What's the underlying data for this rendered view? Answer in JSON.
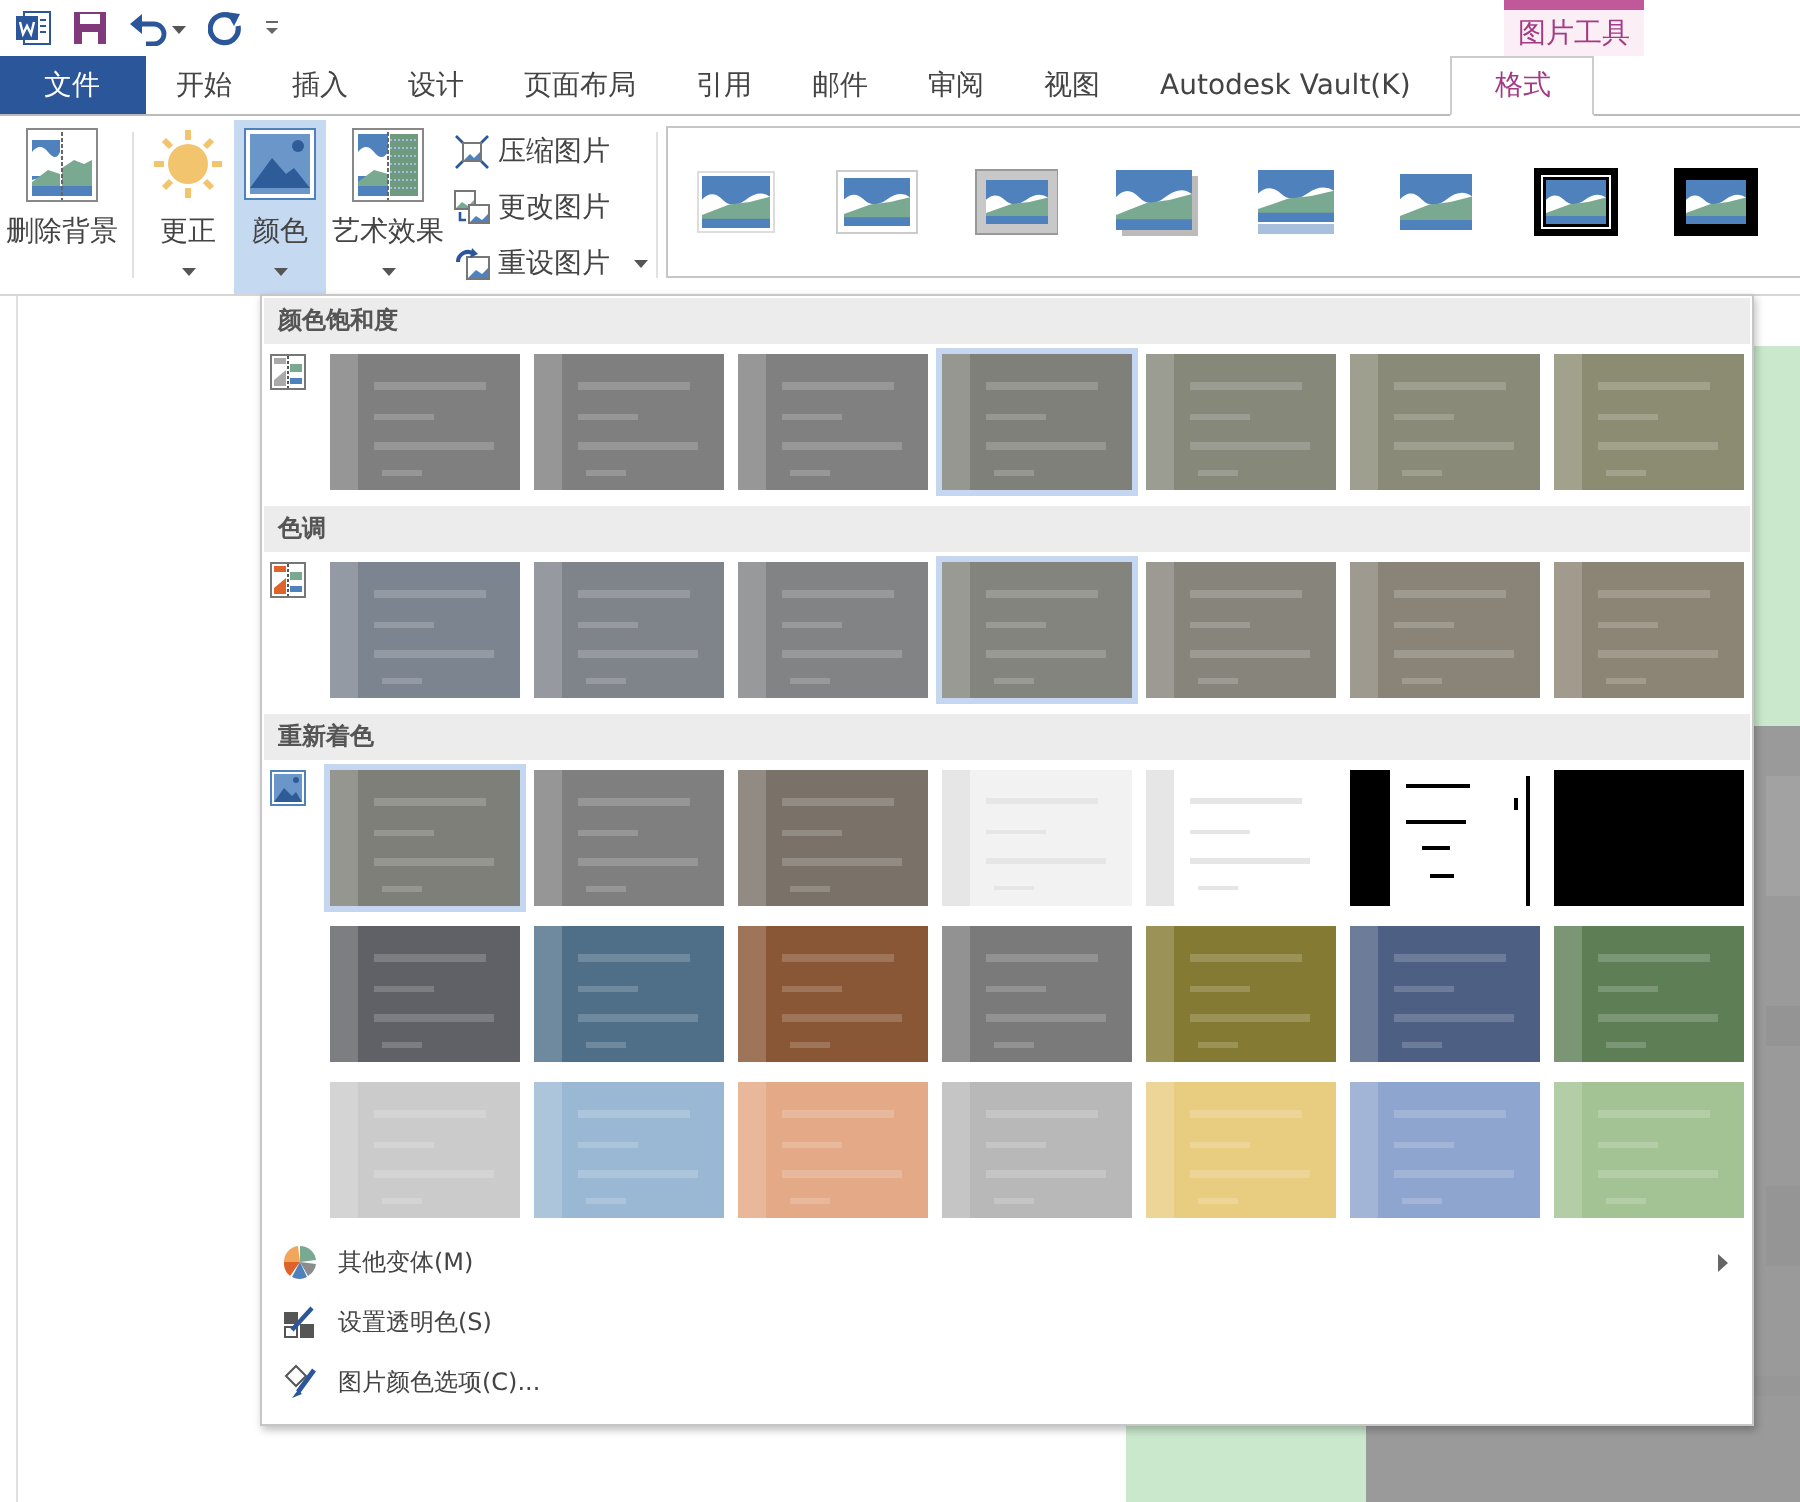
{
  "contextual_group": {
    "label": "图片工具"
  },
  "tabs": [
    {
      "label": "文件",
      "kind": "file",
      "selected": false
    },
    {
      "label": "开始",
      "kind": "normal",
      "selected": false
    },
    {
      "label": "插入",
      "kind": "normal",
      "selected": false
    },
    {
      "label": "设计",
      "kind": "normal",
      "selected": false
    },
    {
      "label": "页面布局",
      "kind": "normal",
      "selected": false
    },
    {
      "label": "引用",
      "kind": "normal",
      "selected": false
    },
    {
      "label": "邮件",
      "kind": "normal",
      "selected": false
    },
    {
      "label": "审阅",
      "kind": "normal",
      "selected": false
    },
    {
      "label": "视图",
      "kind": "normal",
      "selected": false
    },
    {
      "label": "Autodesk Vault(K)",
      "kind": "normal",
      "selected": false
    },
    {
      "label": "格式",
      "kind": "contextual",
      "selected": true
    }
  ],
  "ribbon": {
    "large_buttons": [
      {
        "label": "删除背景",
        "kind": "remove-background",
        "dropdown": false,
        "selected": false
      },
      {
        "label": "更正",
        "kind": "corrections",
        "dropdown": true,
        "selected": false
      },
      {
        "label": "颜色",
        "kind": "color",
        "dropdown": true,
        "selected": true
      },
      {
        "label": "艺术效果",
        "kind": "artistic",
        "dropdown": true,
        "selected": false
      }
    ],
    "small_buttons": [
      {
        "label": "压缩图片",
        "kind": "compress",
        "dropdown": false
      },
      {
        "label": "更改图片",
        "kind": "change",
        "dropdown": false
      },
      {
        "label": "重设图片",
        "kind": "reset",
        "dropdown": true
      }
    ],
    "picture_styles": [
      {
        "kind": "simple-frame"
      },
      {
        "kind": "white-frame"
      },
      {
        "kind": "gray-frame"
      },
      {
        "kind": "drop-shadow"
      },
      {
        "kind": "reflection"
      },
      {
        "kind": "soft-edge"
      },
      {
        "kind": "double-black"
      },
      {
        "kind": "thick-black"
      }
    ]
  },
  "color_menu": {
    "sections": [
      {
        "title": "颜色饱和度",
        "kind": "saturation",
        "rows": [
          [
            {
              "kind": "tint",
              "color": "#7f7f7f",
              "selected": false
            },
            {
              "kind": "tint",
              "color": "#7f7f7f",
              "selected": false
            },
            {
              "kind": "tint",
              "color": "#808080",
              "selected": false
            },
            {
              "kind": "tint",
              "color": "#7f8079",
              "selected": true
            },
            {
              "kind": "tint",
              "color": "#86887a",
              "selected": false
            },
            {
              "kind": "tint",
              "color": "#8a8a78",
              "selected": false
            },
            {
              "kind": "tint",
              "color": "#8c8c73",
              "selected": false
            }
          ]
        ]
      },
      {
        "title": "色调",
        "kind": "tone",
        "rows": [
          [
            {
              "kind": "tint",
              "color": "#7c8490",
              "selected": false
            },
            {
              "kind": "tint",
              "color": "#7f848b",
              "selected": false
            },
            {
              "kind": "tint",
              "color": "#828385",
              "selected": false
            },
            {
              "kind": "tint",
              "color": "#84847e",
              "selected": true
            },
            {
              "kind": "tint",
              "color": "#87847c",
              "selected": false
            },
            {
              "kind": "tint",
              "color": "#8a8478",
              "selected": false
            },
            {
              "kind": "tint",
              "color": "#8c8474",
              "selected": false
            }
          ]
        ]
      },
      {
        "title": "重新着色",
        "kind": "recolor",
        "rows": [
          [
            {
              "kind": "tint",
              "color": "#7e7f78",
              "selected": true
            },
            {
              "kind": "tint",
              "color": "#7f7f7f",
              "selected": false
            },
            {
              "kind": "tint",
              "color": "#7a7268",
              "selected": false
            },
            {
              "kind": "tint",
              "color": "#f2f2f2",
              "selected": false
            },
            {
              "kind": "tint",
              "color": "#ffffff",
              "selected": false
            },
            {
              "kind": "threshold",
              "color": "#ffffff",
              "selected": false
            },
            {
              "kind": "tint",
              "color": "#000000",
              "selected": false
            }
          ],
          [
            {
              "kind": "tint",
              "color": "#5f6166",
              "selected": false
            },
            {
              "kind": "tint",
              "color": "#4f6f89",
              "selected": false
            },
            {
              "kind": "tint",
              "color": "#8a5736",
              "selected": false
            },
            {
              "kind": "tint",
              "color": "#7a7a7a",
              "selected": false
            },
            {
              "kind": "tint",
              "color": "#857a33",
              "selected": false
            },
            {
              "kind": "tint",
              "color": "#4d5f83",
              "selected": false
            },
            {
              "kind": "tint",
              "color": "#5e7f55",
              "selected": false
            }
          ],
          [
            {
              "kind": "tint",
              "color": "#cbcbcb",
              "selected": false
            },
            {
              "kind": "tint",
              "color": "#9ab8d4",
              "selected": false
            },
            {
              "kind": "tint",
              "color": "#e4a986",
              "selected": false
            },
            {
              "kind": "tint",
              "color": "#b8b8b8",
              "selected": false
            },
            {
              "kind": "tint",
              "color": "#e8cc80",
              "selected": false
            },
            {
              "kind": "tint",
              "color": "#8ea5cf",
              "selected": false
            },
            {
              "kind": "tint",
              "color": "#a3c394",
              "selected": false
            }
          ]
        ]
      }
    ],
    "commands": [
      {
        "label": "其他变体(M)",
        "kind": "more-variations",
        "submenu": true
      },
      {
        "label": "设置透明色(S)",
        "kind": "transparent",
        "submenu": false
      },
      {
        "label": "图片颜色选项(C)...",
        "kind": "options",
        "submenu": false
      }
    ]
  }
}
